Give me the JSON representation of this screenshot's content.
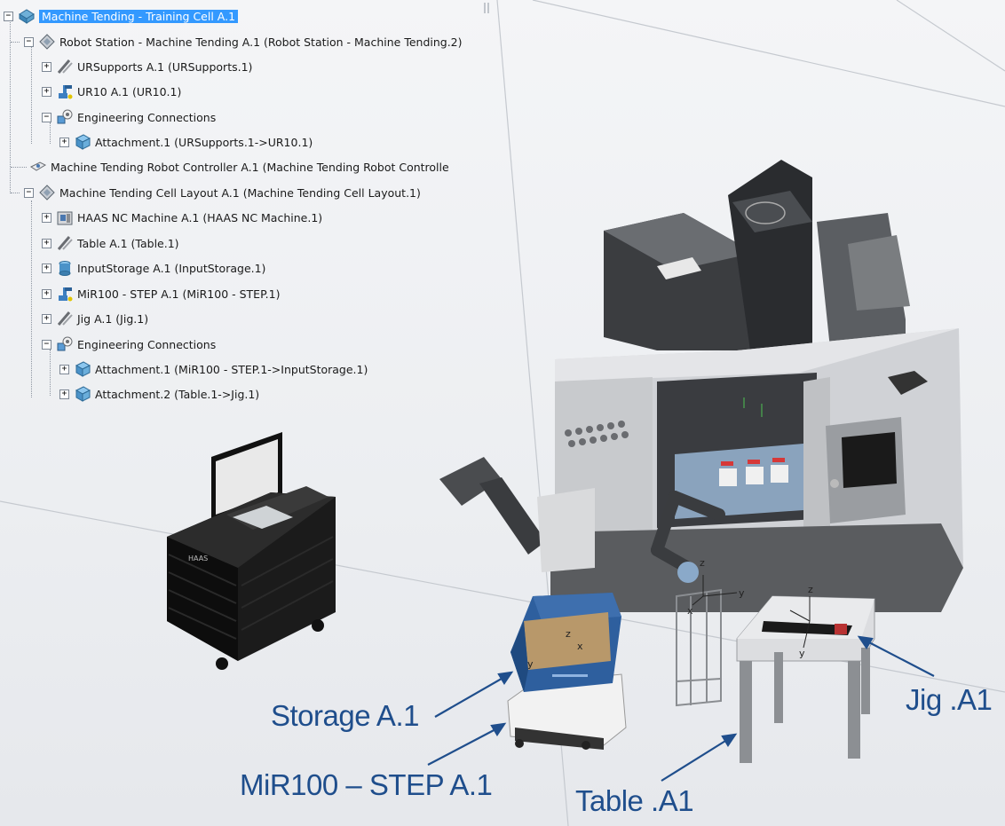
{
  "tree": {
    "root": {
      "label": "Machine Tending - Training Cell A.1",
      "icon": "product-root-icon"
    },
    "items": [
      {
        "label": "Robot Station - Machine Tending A.1 (Robot Station - Machine Tending.2)",
        "icon": "product-icon"
      },
      {
        "label": "URSupports A.1 (URSupports.1)",
        "icon": "support-part-icon"
      },
      {
        "label": "UR10 A.1 (UR10.1)",
        "icon": "robot-icon"
      },
      {
        "label": "Engineering Connections",
        "icon": "engineering-connections-icon"
      },
      {
        "label": "Attachment.1 (URSupports.1->UR10.1)",
        "icon": "attachment-icon"
      },
      {
        "label": "Machine Tending Robot Controller A.1 (Machine Tending Robot Controlle",
        "icon": "controller-icon"
      },
      {
        "label": "Machine Tending Cell Layout A.1 (Machine Tending Cell Layout.1)",
        "icon": "product-icon"
      },
      {
        "label": "HAAS NC Machine A.1 (HAAS NC Machine.1)",
        "icon": "nc-machine-icon"
      },
      {
        "label": "Table A.1 (Table.1)",
        "icon": "support-part-icon"
      },
      {
        "label": "InputStorage A.1 (InputStorage.1)",
        "icon": "storage-icon"
      },
      {
        "label": "MiR100 - STEP A.1 (MiR100 - STEP.1)",
        "icon": "robot-icon"
      },
      {
        "label": "Jig A.1 (Jig.1)",
        "icon": "support-part-icon"
      },
      {
        "label": "Engineering Connections",
        "icon": "engineering-connections-icon"
      },
      {
        "label": "Attachment.1 (MiR100 - STEP.1->InputStorage.1)",
        "icon": "attachment-icon"
      },
      {
        "label": "Attachment.2 (Table.1->Jig.1)",
        "icon": "attachment-icon"
      }
    ],
    "expander_collapsed": "+",
    "expander_expanded": "−"
  },
  "viewport": {
    "callouts": {
      "storage": "Storage A.1",
      "mir": "MiR100 – STEP A.1",
      "table": "Table .A1",
      "jig": "Jig .A1"
    },
    "axis_labels": {
      "x": "x",
      "y": "y",
      "z": "z"
    },
    "cart_brand": "HAAS"
  },
  "colors": {
    "selection": "#3399ff",
    "callout_text": "#1f4e8c",
    "callout_arrow": "#1f4e8c",
    "machine_body": "#d4d6d9",
    "machine_dark": "#4d5054",
    "storage_blue": "#2e5f9e",
    "storage_tan": "#b8986a"
  }
}
